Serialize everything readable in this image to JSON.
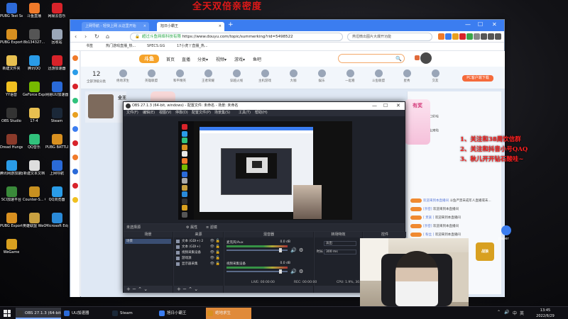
{
  "banner_text": "全天双倍亲密度",
  "desktop_icons": [
    {
      "label": "PUBG Test Server",
      "color": "#2d6ad8"
    },
    {
      "label": "斗鱼直播",
      "color": "#f07a2a"
    },
    {
      "label": "网易云音乐",
      "color": "#d8232a"
    },
    {
      "label": "PUBG Export...",
      "color": "#d89020"
    },
    {
      "label": "8b134327...",
      "color": "#555555"
    },
    {
      "label": "回收站",
      "color": "#9aa6b8"
    },
    {
      "label": "新建文件夹",
      "color": "#e8c050"
    },
    {
      "label": "腾讯QQ",
      "color": "#2a9ce8"
    },
    {
      "label": "迅游加速器",
      "color": "#d8232a"
    },
    {
      "label": "YY语音",
      "color": "#f0c020"
    },
    {
      "label": "GeForce Experience",
      "color": "#76b900"
    },
    {
      "label": "网易UU加速器",
      "color": "#2a6ad8"
    },
    {
      "label": "OBS Studio",
      "color": "#333333"
    },
    {
      "label": "17-4",
      "color": "#e8c050"
    },
    {
      "label": "Steam",
      "color": "#1b2838"
    },
    {
      "label": "Dread Hunger",
      "color": "#8a3a2a"
    },
    {
      "label": "QQ音乐",
      "color": "#31c27c"
    },
    {
      "label": "PUBG BATTLEGR...",
      "color": "#d89020"
    },
    {
      "label": "腾讯网游加速器",
      "color": "#2a9ce8"
    },
    {
      "label": "新建文本文档",
      "color": "#dddddd"
    },
    {
      "label": "上网导航",
      "color": "#2a6ad8"
    },
    {
      "label": "SCI加速平台",
      "color": "#3a8a3a"
    },
    {
      "label": "Counter-S... Global Off...",
      "color": "#c89020"
    },
    {
      "label": "QQ浏览器",
      "color": "#2a9ce8"
    },
    {
      "label": "PUBG Export...",
      "color": "#d89020"
    },
    {
      "label": "英雄联盟 WeGame版",
      "color": "#c8a040"
    },
    {
      "label": "Microsoft Edge",
      "color": "#2a8ad8"
    },
    {
      "label": "WeGame",
      "color": "#d8a020"
    }
  ],
  "browser": {
    "tabs": [
      {
        "label": "上网导航 - 轻快上网 从这里开始",
        "close": "×"
      },
      {
        "label": "旭日小霸王",
        "close": "×"
      }
    ],
    "tab_add": "+",
    "window_controls": [
      "—",
      "☐",
      "✕"
    ],
    "nav_glyphs": [
      "‹",
      "›",
      "↻",
      "⌂"
    ],
    "url_prefix": "超过斗鱼网络科技有限",
    "url": "https://www.douyu.com/topic/summerking?rid=5498522",
    "search_text": "燕坦微出图片大爆开功能",
    "bookmarks": [
      "书签",
      "热门游戏直播_热...",
      "SPECS.GG",
      "17小虎丫直播_热..."
    ],
    "tool_icon_colors": [
      "#f07a2a",
      "#3b7df0",
      "#e8a020",
      "#d8232a",
      "#3aa64a",
      "#888888",
      "#555555",
      "#555555",
      "#555555"
    ],
    "side_colors": [
      "#f07a2a",
      "#2a9ce8",
      "#d8232a",
      "#31c27c",
      "#e8a020",
      "#3b7df0",
      "#d8232a",
      "#f07a2a",
      "#2a6ad8",
      "#d8232a",
      "#f0c020"
    ]
  },
  "douyu": {
    "logo": "斗鱼",
    "nav": [
      "首页",
      "直播",
      "分类▾",
      "视频▾",
      "游戏▾",
      "鱼吧"
    ],
    "search_icon": "🔍",
    "cats_count": "12",
    "cats_count_label": "全部顶级分类",
    "cats": [
      "绝地求生",
      "英雄联盟",
      "和平精英",
      "王者荣耀",
      "穿越火线",
      "主机游戏",
      "大咖",
      "娱乐",
      "一起看",
      "斗鱼联盟",
      "星秀",
      "交友"
    ],
    "pc_button": "PC客户端下载",
    "streamer_name": "全王",
    "chat_top": [
      "水一鱼口彩哇",
      "小鱼鱼出来啦"
    ],
    "chat_rows": [
      {
        "name": "欢迎来到本直播间",
        "text": "斗鱼严禁未成年人直播或未..."
      },
      {
        "name": "[亲密]",
        "text": "欢迎来到本直播间"
      },
      {
        "name": "[ 贵族 ]",
        "text": "欢迎来到本直播间"
      },
      {
        "name": "[亲密]",
        "text": "欢迎来到本直播间"
      },
      {
        "name": "[ 粉丝 ]",
        "text": "欢迎来到本直播间"
      },
      {
        "name": "[亲密]",
        "text": "欢迎来到本直播间"
      },
      {
        "name": "[ 粉丝 ]",
        "text": "欢迎来到本直播间"
      },
      {
        "name": "[亲密]",
        "text": "欢迎来到本直播间"
      },
      {
        "name": "[ 粉丝 ]",
        "text": "欢迎来到本直播间"
      }
    ],
    "promo_text": "有奖"
  },
  "overlay_lines": [
    "1、关注和38周饮信群",
    "2、关注和抖音小号QAQ",
    "3、秋儿开开钻石酸哇~"
  ],
  "obs": {
    "title": "OBS 27.1.3 (64-bit, windows) - 配置文件: 未命名 - 场景: 未命名",
    "window_controls": [
      "—",
      "☐",
      "✕"
    ],
    "menu": [
      "文件(F)",
      "编辑(E)",
      "视图(V)",
      "停靠(D)",
      "配置文件(P)",
      "场景集(S)",
      "工具(T)",
      "帮助(H)"
    ],
    "scene_bar": {
      "label": "未选择源",
      "props": "⚙ 属性",
      "filters": "≡ 滤镜"
    },
    "docks": {
      "scenes": "场景",
      "sources": "来源",
      "mixer": "混音器",
      "transitions": "转场特效",
      "controls": "控件"
    },
    "scenes": [
      "场景"
    ],
    "sources": [
      "文本 (GDI+) 2",
      "文本 (GDI+)",
      "视频采集设备",
      "游戏源",
      "显示器采集"
    ],
    "mixer": [
      {
        "name": "麦克风/Aux",
        "level": "0.0 dB",
        "knob": 0.9
      },
      {
        "name": "视频采集设备",
        "level": "0.0 dB",
        "knob": 0.9
      }
    ],
    "transition": {
      "label": "淡出",
      "duration_label": "时长",
      "duration": "300 ms"
    },
    "dock_foot": "+  −  ⌃  ⌄",
    "status": {
      "live": "LIVE: 00:00:00",
      "rec": "REC: 00:00:00",
      "cpu": "CPU: 1.9%, 30.00 fps",
      "fps_short": "CPU"
    },
    "nested_strip_colors": [
      "#d8232a",
      "#2a9ce8",
      "#31c27c",
      "#d89020",
      "#e8e8e8",
      "#f07a2a",
      "#76b900",
      "#2a6ad8",
      "#aaaaaa",
      "#c8a040",
      "#2a8ad8",
      "#333333",
      "#d8a020",
      "#555555"
    ]
  },
  "logo_badge": "战狼",
  "peek_label": "paper",
  "taskbar": {
    "items": [
      {
        "label": "OBS 27.1.3 (64-bit...",
        "color": "#333333",
        "state": "active"
      },
      {
        "label": "UU加速器",
        "color": "#2a6ad8",
        "state": "normal"
      },
      {
        "label": "Steam",
        "color": "#1b2838",
        "state": "normal"
      },
      {
        "label": "旭日小霸王",
        "color": "#3b7df0",
        "state": "normal"
      },
      {
        "label": "绝地求生",
        "color": "#d89020",
        "state": "highlight"
      }
    ],
    "tray": [
      "⌃",
      "🔊",
      "中",
      "英"
    ],
    "time": "13:45",
    "date": "2022/6/29"
  }
}
